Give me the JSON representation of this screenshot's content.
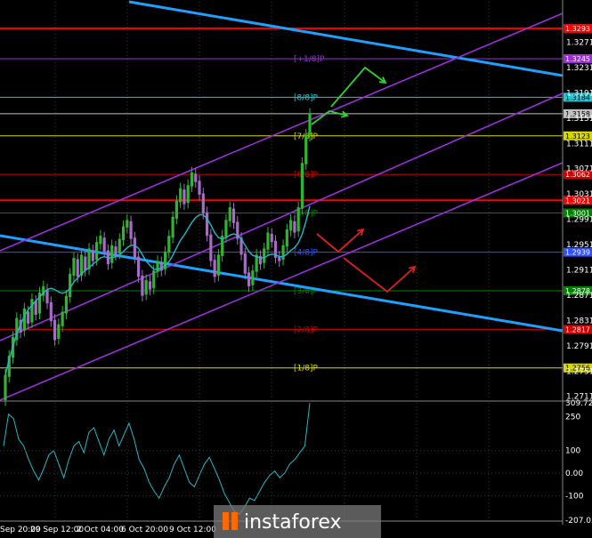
{
  "chart_data": [
    {
      "type": "candlestick",
      "price_axis": {
        "ticks": [
          "1.3271",
          "1.3231",
          "1.3191",
          "1.3151",
          "1.3111",
          "1.3071",
          "1.3031",
          "1.2991",
          "1.2951",
          "1.2911",
          "1.2871",
          "1.2831",
          "1.2791",
          "1.2751",
          "1.2711"
        ],
        "range": [
          1.2705,
          1.3335
        ]
      },
      "time_axis": {
        "labels": [
          "Sep 20:00",
          "29 Sep 12:00",
          "2 Oct 04:00",
          "6 Oct 20:00",
          "9 Oct 12:00"
        ]
      },
      "murrey_levels": [
        {
          "label": "",
          "value": 1.3293,
          "badge": "1.3293",
          "color": "#ff0000"
        },
        {
          "label": "[+1/8]P",
          "value": 1.3245,
          "badge": "1.3245",
          "color": "#9a30d8"
        },
        {
          "label": "[8/8]P",
          "value": 1.3184,
          "badge": "1.3184",
          "color": "#20c8d8"
        },
        {
          "label": "",
          "value": 1.3158,
          "badge": "1.3158",
          "color": "#c0c0c0"
        },
        {
          "label": "[7/8]P",
          "value": 1.3123,
          "badge": "1.3123",
          "color": "#d8d800"
        },
        {
          "label": "[6/8]P",
          "value": 1.3062,
          "badge": "1.3062",
          "color": "#d00000"
        },
        {
          "label": "",
          "value": 1.3021,
          "badge": "1.3021",
          "color": "#ff0000"
        },
        {
          "label": "[5/8]P",
          "value": 1.3001,
          "badge": "1.3001",
          "color": "#008000"
        },
        {
          "label": "[4/8]P",
          "value": 1.2939,
          "badge": "1.2939",
          "color": "#3050ff"
        },
        {
          "label": "[3/8]P",
          "value": 1.2878,
          "badge": "1.2878",
          "color": "#008000"
        },
        {
          "label": "[2/8]P",
          "value": 1.2817,
          "badge": "1.2817",
          "color": "#d00000"
        },
        {
          "label": "[1/8]P",
          "value": 1.2756,
          "badge": "1.2756",
          "color": "#d8d800"
        }
      ],
      "candles": [
        [
          1.2705,
          1.2745
        ],
        [
          1.2742,
          1.2775
        ],
        [
          1.2772,
          1.2805
        ],
        [
          1.28,
          1.2835
        ],
        [
          1.2832,
          1.2812
        ],
        [
          1.2815,
          1.285
        ],
        [
          1.2845,
          1.2826
        ],
        [
          1.2828,
          1.2865
        ],
        [
          1.2862,
          1.284
        ],
        [
          1.2842,
          1.2875
        ],
        [
          1.287,
          1.2885
        ],
        [
          1.288,
          1.2858
        ],
        [
          1.286,
          1.283
        ],
        [
          1.2832,
          1.28
        ],
        [
          1.2802,
          1.2825
        ],
        [
          1.2822,
          1.2845
        ],
        [
          1.2842,
          1.287
        ],
        [
          1.2868,
          1.2905
        ],
        [
          1.2902,
          1.293
        ],
        [
          1.2928,
          1.29
        ],
        [
          1.2902,
          1.2935
        ],
        [
          1.2932,
          1.291
        ],
        [
          1.2912,
          1.2945
        ],
        [
          1.2942,
          1.2925
        ],
        [
          1.2927,
          1.2955
        ],
        [
          1.2952,
          1.2965
        ],
        [
          1.2962,
          1.294
        ],
        [
          1.2942,
          1.292
        ],
        [
          1.2922,
          1.295
        ],
        [
          1.2948,
          1.2935
        ],
        [
          1.2937,
          1.296
        ],
        [
          1.2958,
          1.298
        ],
        [
          1.2978,
          1.299
        ],
        [
          1.2988,
          1.296
        ],
        [
          1.2962,
          1.293
        ],
        [
          1.2932,
          1.29
        ],
        [
          1.2902,
          1.287
        ],
        [
          1.2872,
          1.2895
        ],
        [
          1.2893,
          1.288
        ],
        [
          1.2882,
          1.291
        ],
        [
          1.2908,
          1.2925
        ],
        [
          1.2923,
          1.291
        ],
        [
          1.2912,
          1.294
        ],
        [
          1.2938,
          1.2965
        ],
        [
          1.2962,
          1.2995
        ],
        [
          1.2992,
          1.302
        ],
        [
          1.3018,
          1.304
        ],
        [
          1.3038,
          1.3015
        ],
        [
          1.3017,
          1.3045
        ],
        [
          1.3043,
          1.3065
        ],
        [
          1.3063,
          1.305
        ],
        [
          1.3052,
          1.303
        ],
        [
          1.3032,
          1.3
        ],
        [
          1.3002,
          1.2965
        ],
        [
          1.2967,
          1.2925
        ],
        [
          1.2927,
          1.29
        ],
        [
          1.2902,
          1.2935
        ],
        [
          1.2933,
          1.2965
        ],
        [
          1.2963,
          1.299
        ],
        [
          1.2988,
          1.301
        ],
        [
          1.3008,
          1.2985
        ],
        [
          1.2987,
          1.296
        ],
        [
          1.2962,
          1.2935
        ],
        [
          1.2937,
          1.2905
        ],
        [
          1.2907,
          1.2885
        ],
        [
          1.2887,
          1.291
        ],
        [
          1.2908,
          1.2935
        ],
        [
          1.2933,
          1.292
        ],
        [
          1.2922,
          1.2945
        ],
        [
          1.2943,
          1.297
        ],
        [
          1.2968,
          1.2955
        ],
        [
          1.2957,
          1.293
        ],
        [
          1.2932,
          1.2925
        ],
        [
          1.2927,
          1.295
        ],
        [
          1.2948,
          1.2975
        ],
        [
          1.2973,
          1.299
        ],
        [
          1.2988,
          1.297
        ],
        [
          1.2972,
          1.301
        ],
        [
          1.3008,
          1.308
        ],
        [
          1.3078,
          1.3125
        ],
        [
          1.3123,
          1.3158
        ]
      ],
      "sma": [
        1.2745,
        1.277,
        1.279,
        1.281,
        1.2825,
        1.2838,
        1.2848,
        1.2855,
        1.2862,
        1.2868,
        1.2875,
        1.288,
        1.2882,
        1.288,
        1.2876,
        1.2874,
        1.2876,
        1.2882,
        1.2892,
        1.2898,
        1.2905,
        1.291,
        1.2915,
        1.292,
        1.2925,
        1.293,
        1.2932,
        1.293,
        1.293,
        1.2932,
        1.2935,
        1.294,
        1.2946,
        1.295,
        1.295,
        1.2945,
        1.2935,
        1.2925,
        1.2918,
        1.2912,
        1.2912,
        1.2914,
        1.2918,
        1.2924,
        1.2934,
        1.2946,
        1.2958,
        1.2966,
        1.2976,
        1.2986,
        1.2994,
        1.2998,
        1.2998,
        1.2992,
        1.2982,
        1.297,
        1.2962,
        1.296,
        1.2962,
        1.2966,
        1.2968,
        1.2966,
        1.296,
        1.295,
        1.294,
        1.2934,
        1.2932,
        1.293,
        1.293,
        1.2934,
        1.2936,
        1.2935,
        1.2932,
        1.2932,
        1.2936,
        1.2942,
        1.2946,
        1.2954,
        1.2968,
        1.2988,
        1.3012
      ],
      "oscillator": {
        "ticks": [
          "309.7227",
          "250",
          "100",
          "0.00",
          "-100",
          "-207.059"
        ],
        "range": [
          -207.059,
          309.7227
        ],
        "values": [
          120,
          260,
          240,
          150,
          120,
          60,
          10,
          -30,
          20,
          80,
          100,
          40,
          -20,
          60,
          120,
          140,
          90,
          180,
          200,
          140,
          80,
          150,
          190,
          120,
          170,
          220,
          150,
          60,
          20,
          -40,
          -80,
          -110,
          -60,
          -20,
          40,
          80,
          20,
          -40,
          -60,
          -10,
          40,
          70,
          20,
          -30,
          -90,
          -130,
          -170,
          -180,
          -150,
          -110,
          -120,
          -80,
          -40,
          -10,
          10,
          -20,
          0,
          40,
          60,
          90,
          120,
          309
        ]
      },
      "trendlines": [
        "descending",
        "descending",
        "ascending-channel-upper",
        "ascending-channel-upper2",
        "ascending-channel-lower",
        "ascending-channel-lower2"
      ],
      "arrows": [
        "green-up",
        "green-down",
        "red-down",
        "red-up"
      ],
      "watermark": "instaforex"
    }
  ]
}
